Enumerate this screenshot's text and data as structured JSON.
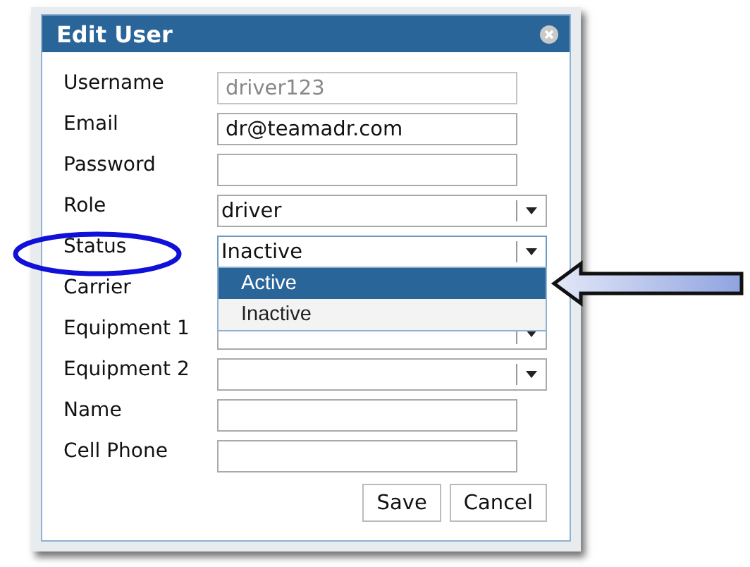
{
  "dialog": {
    "title": "Edit User"
  },
  "fields": [
    {
      "label": "Username",
      "kind": "text",
      "value": "driver123",
      "disabled": true
    },
    {
      "label": "Email",
      "kind": "text",
      "value": "dr@teamadr.com"
    },
    {
      "label": "Password",
      "kind": "text"
    },
    {
      "label": "Role",
      "kind": "select",
      "value": "driver"
    },
    {
      "label": "Status",
      "kind": "select",
      "value": "Inactive",
      "expanded": true,
      "highlighted": true,
      "options": [
        {
          "label": "Active",
          "highlighted": true
        },
        {
          "label": "Inactive",
          "highlighted": false
        }
      ]
    },
    {
      "label": "Carrier"
    },
    {
      "label": "Equipment 1",
      "kind": "select"
    },
    {
      "label": "Equipment 2",
      "kind": "select"
    },
    {
      "label": "Name",
      "kind": "text"
    },
    {
      "label": "Cell Phone",
      "kind": "text"
    }
  ],
  "buttons": [
    "Save",
    "Cancel"
  ]
}
